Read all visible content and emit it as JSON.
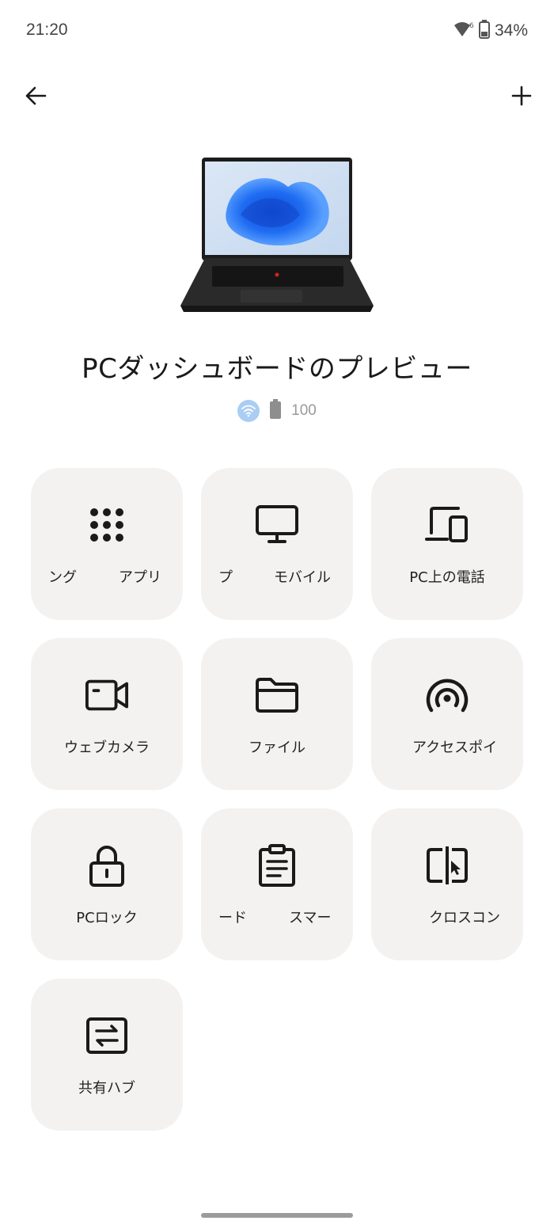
{
  "status_bar": {
    "time": "21:20",
    "battery_percent": "34%",
    "wifi_icon": "wifi-question-icon",
    "battery_icon": "battery-icon"
  },
  "top_bar": {
    "back_icon": "arrow-left-icon",
    "add_icon": "plus-icon"
  },
  "device": {
    "image": "laptop-image",
    "title": "PCダッシュボードのプレビュー",
    "connection_icon": "wifi-icon",
    "battery_icon": "battery-icon",
    "battery_level": "100"
  },
  "tiles": [
    {
      "icon": "apps-grid-icon",
      "label_parts": [
        "ング",
        "アプリ"
      ]
    },
    {
      "icon": "monitor-icon",
      "label_parts": [
        "プ",
        "モバイル"
      ]
    },
    {
      "icon": "phone-on-pc-icon",
      "label": "PC上の電話"
    },
    {
      "icon": "webcam-icon",
      "label": "ウェブカメラ"
    },
    {
      "icon": "folder-icon",
      "label": "ファイル"
    },
    {
      "icon": "hotspot-icon",
      "label": "アクセスポイ"
    },
    {
      "icon": "lock-icon",
      "label": "PCロック"
    },
    {
      "icon": "clipboard-icon",
      "label_parts": [
        "ード",
        "スマー"
      ]
    },
    {
      "icon": "cross-control-icon",
      "label": "クロスコン"
    },
    {
      "icon": "share-hub-icon",
      "label": "共有ハブ"
    }
  ],
  "colors": {
    "tile_bg": "#f3f2f0",
    "wifi_badge": "#a9cdf3",
    "text": "#1a1a1a"
  }
}
